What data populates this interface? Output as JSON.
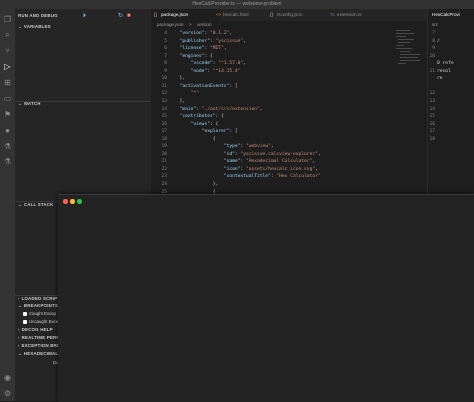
{
  "window": {
    "title": "HexCalcProvider.ts — webview-problem"
  },
  "activity_bar": {
    "icons": [
      "files-icon",
      "search-icon",
      "source-control-icon",
      "run-debug-icon",
      "extensions-icon",
      "remote-icon",
      "bookmark-icon",
      "github-icon",
      "testing-icon",
      "account-icon",
      "settings-icon"
    ]
  },
  "sidebar": {
    "title": "RUN AND DEBUG",
    "sections": {
      "variables": "VARIABLES",
      "watch": "WATCH",
      "call_stack": "CALL STACK",
      "loaded_scripts": "LOADED SCRIPTS",
      "breakpoints": "BREAKPOINTS",
      "deco_help": "DECOG HELP",
      "realtime": "REALTIME PERFORM",
      "exception": "EXCEPTION BREAKP",
      "hexadecimal": "HEXADECIMAL CAL"
    },
    "breakpoints": [
      {
        "label": "Caught Excep"
      },
      {
        "label": "Uncaught Exce"
      }
    ],
    "trailing_item": "Do"
  },
  "editor": {
    "tabs": [
      {
        "label": "package.json",
        "icon": "{}"
      },
      {
        "label": "hexcalc.html",
        "icon": "<>"
      },
      {
        "label": "tsconfig.json",
        "icon": "{}"
      },
      {
        "label": "extension.ts",
        "icon": "TS"
      }
    ],
    "breadcrumb": {
      "file": "package.json",
      "separator": ">",
      "node": "version"
    },
    "lines": [
      {
        "n": "4",
        "text": "  \"version\": \"0.1.2\","
      },
      {
        "n": "5",
        "text": "  \"publisher\": \"yscissue\","
      },
      {
        "n": "6",
        "text": "  \"license\": \"MIT\","
      },
      {
        "n": "7",
        "text": "  \"engines\": {"
      },
      {
        "n": "8",
        "text": "      \"vscode\": \"^1.57.0\","
      },
      {
        "n": "9",
        "text": "      \"node\": \"^14.15.4\""
      },
      {
        "n": "10",
        "text": "  },"
      },
      {
        "n": "11",
        "text": "  \"activationEvents\": ["
      },
      {
        "n": "12",
        "text": "      \"*\""
      },
      {
        "n": "13",
        "text": "  ],"
      },
      {
        "n": "14",
        "text": "  \"main\": \"./out/src/extension\","
      },
      {
        "n": "15",
        "text": "  \"contributes\": {"
      },
      {
        "n": "16",
        "text": "      \"views\": {"
      },
      {
        "n": "17",
        "text": "          \"explorer\": ["
      },
      {
        "n": "18",
        "text": "              {"
      },
      {
        "n": "19",
        "text": "                  \"type\": \"webview\","
      },
      {
        "n": "20",
        "text": "                  \"id\": \"yscissue.calcview-explorer\","
      },
      {
        "n": "21",
        "text": "                  \"name\": \"Hexadecimal Calculator\","
      },
      {
        "n": "22",
        "text": "                  \"icon\": \"assets/hexcalc_icon.svg\","
      },
      {
        "n": "23",
        "text": "                  \"contextualTitle\": \"Hex Calculator\""
      },
      {
        "n": "24",
        "text": "              },"
      },
      {
        "n": "25",
        "text": "              {"
      }
    ]
  },
  "right_pane": {
    "tab_label": "HexCalcProvi",
    "breadcrumb": "src",
    "lines": [
      {
        "n": "7",
        "text": ""
      },
      {
        "n": "8",
        "text": "/"
      },
      {
        "n": "9",
        "text": ""
      },
      {
        "n": "10",
        "text": ""
      },
      {
        "n": "",
        "text": "0 refe"
      },
      {
        "n": "11",
        "text": "resol"
      },
      {
        "n": "",
        "text": "re"
      },
      {
        "n": "",
        "text": ""
      },
      {
        "n": "12",
        "text": ""
      },
      {
        "n": "13",
        "text": ""
      },
      {
        "n": "14",
        "text": ""
      },
      {
        "n": "15",
        "text": ""
      },
      {
        "n": "16",
        "text": ""
      },
      {
        "n": "17",
        "text": ""
      },
      {
        "n": "18",
        "text": ""
      }
    ]
  },
  "colors": {
    "title_bar": "#323233",
    "activity_bar": "#333333",
    "sidebar": "#252526",
    "editor": "#1e1e1e",
    "close_dot": "#fe5f57",
    "minimize_dot": "#febc2e",
    "zoom_dot": "#28c840",
    "debug_continue": "#75beff",
    "debug_stop": "#f48771"
  }
}
